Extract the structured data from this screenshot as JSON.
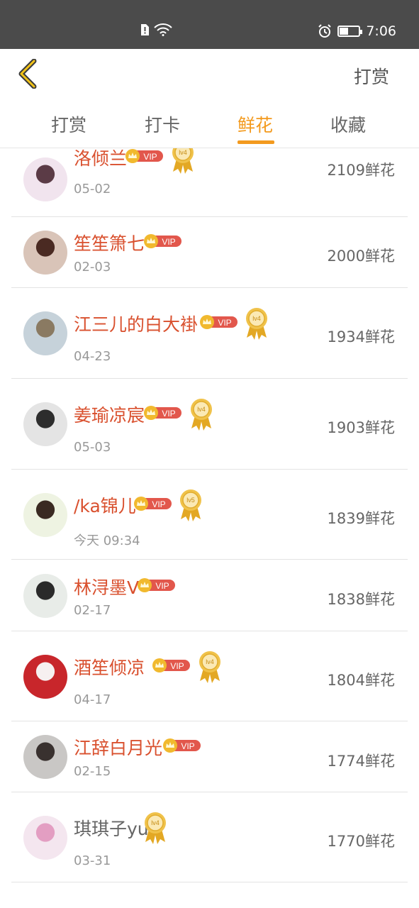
{
  "status_bar": {
    "time": "7:06"
  },
  "header": {
    "action_label": "打赏"
  },
  "tabs": [
    "打赏",
    "打卡",
    "鲜花",
    "收藏"
  ],
  "active_tab": 2,
  "vip_label": "VIP",
  "rows": [
    {
      "name": "洛倾兰",
      "date": "05-02",
      "amount": "2109鲜花",
      "vip": true,
      "level": "lv4"
    },
    {
      "name": "笙笙箫七",
      "date": "02-03",
      "amount": "2000鲜花",
      "vip": true,
      "level": ""
    },
    {
      "name": "江三儿的白大褂",
      "date": "04-23",
      "amount": "1934鲜花",
      "vip": true,
      "level": "lv4"
    },
    {
      "name": "姜瑜凉宸",
      "date": "05-03",
      "amount": "1903鲜花",
      "vip": true,
      "level": "lv4"
    },
    {
      "name": "/ka锦儿",
      "date": "今天 09:34",
      "amount": "1839鲜花",
      "vip": true,
      "level": "lv5"
    },
    {
      "name": "林浔墨V",
      "date": "02-17",
      "amount": "1838鲜花",
      "vip": true,
      "level": ""
    },
    {
      "name": "酒笙倾凉",
      "date": "04-17",
      "amount": "1804鲜花",
      "vip": true,
      "level": "lv4"
    },
    {
      "name": "江辞白月光",
      "date": "02-15",
      "amount": "1774鲜花",
      "vip": true,
      "level": ""
    },
    {
      "name": "琪琪子yu",
      "date": "03-31",
      "amount": "1770鲜花",
      "vip": false,
      "level": "lv4"
    }
  ],
  "colors": {
    "accent": "#f39a1e",
    "name_red": "#d9502e",
    "vip_red": "#e2574c",
    "gold": "#e8b23a"
  },
  "icons": {
    "back": "chevron-left-icon",
    "vip": "crown-vip-badge-icon",
    "level": "medal-level-icon"
  }
}
